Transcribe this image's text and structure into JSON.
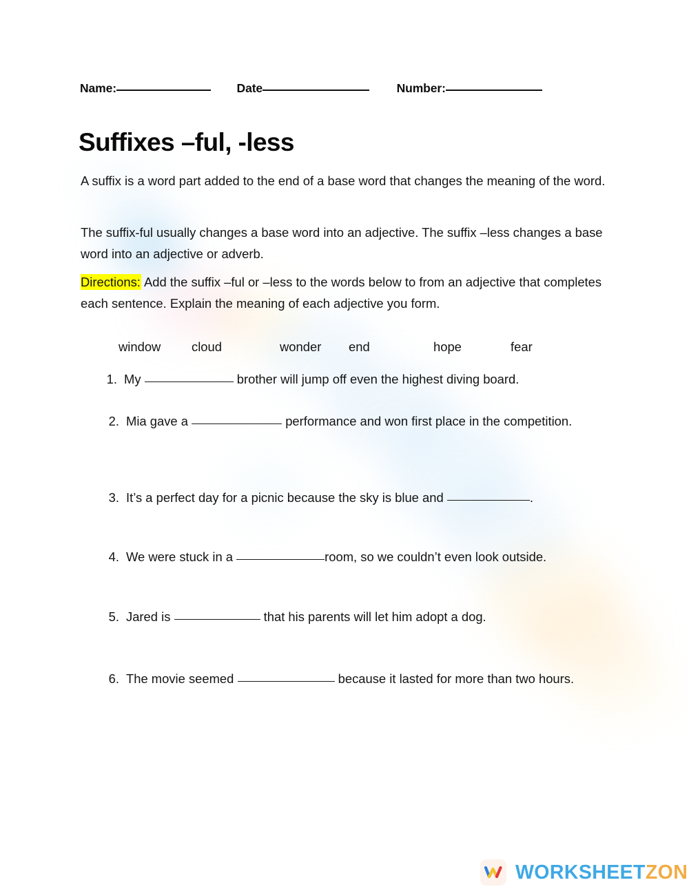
{
  "page": {
    "background": "#ffffff",
    "highlight_color": "#ffff00",
    "text_color": "#141414"
  },
  "header": {
    "name_label": "Name:",
    "date_label": "Date",
    "number_label": "Number:"
  },
  "title": "Suffixes –ful, -less",
  "intro": {
    "paragraph_1": "A suffix is a word part added to the end of a base word that changes the meaning of the word.",
    "paragraph_2": "The suffix-ful usually changes a base word into an adjective. The suffix –less changes a base word into an adjective or adverb.",
    "directions_label": "Directions:",
    "directions_text": " Add the suffix –ful or –less to the words below to from an adjective that completes each sentence. Explain the meaning of each adjective you form."
  },
  "word_bank": [
    "window",
    "cloud",
    "wonder",
    "end",
    "hope",
    "fear"
  ],
  "questions": [
    {
      "number": "1.",
      "before": "My ",
      "after": " brother will jump off even the highest diving board."
    },
    {
      "number": "2.",
      "before": "Mia gave a ",
      "after": " performance and won first place in the competition."
    },
    {
      "number": "3.",
      "before": "It’s a perfect day for a picnic because the sky is blue and ",
      "after": "."
    },
    {
      "number": "4.",
      "before": "We were stuck in a ",
      "after": "room, so we couldn’t even look outside."
    },
    {
      "number": "5.",
      "before": "Jared is ",
      "after": " that his parents will let him adopt a dog."
    },
    {
      "number": "6.",
      "before": "The movie seemed ",
      "after": " because it lasted for more than two hours."
    }
  ],
  "footer": {
    "brand_primary": "WORKSHEET",
    "brand_secondary": "ZONE",
    "brand_primary_color": "#3ea8e5",
    "brand_secondary_color": "#f0ac45"
  }
}
